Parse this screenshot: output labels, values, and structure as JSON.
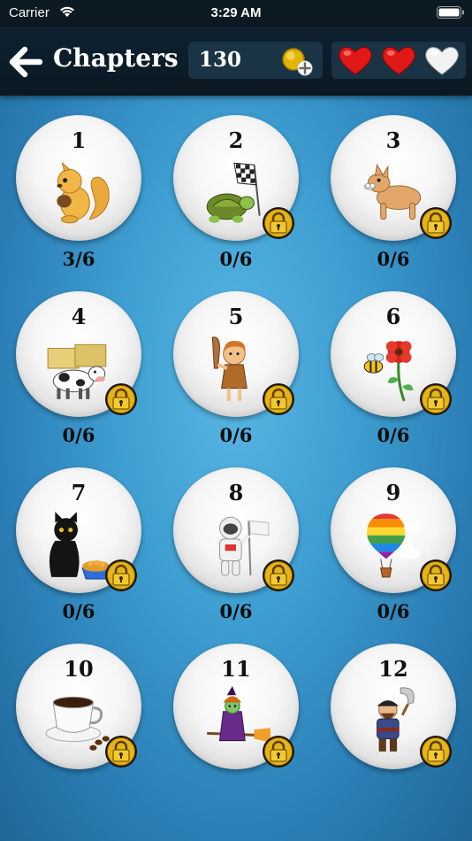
{
  "status_bar": {
    "carrier": "Carrier",
    "time": "3:29 AM"
  },
  "header": {
    "title": "Chapters",
    "coins": "130",
    "lives": [
      "full",
      "full",
      "empty"
    ]
  },
  "colors": {
    "heart_full": "#e01818",
    "heart_empty": "#f2f2f2",
    "coin": "#e0b400"
  },
  "chapters": [
    {
      "number": "1",
      "progress": "3/6",
      "locked": false,
      "icon": "squirrel-icon"
    },
    {
      "number": "2",
      "progress": "0/6",
      "locked": true,
      "icon": "turtle-flag-icon"
    },
    {
      "number": "3",
      "progress": "0/6",
      "locked": true,
      "icon": "dog-icon"
    },
    {
      "number": "4",
      "progress": "0/6",
      "locked": true,
      "icon": "cow-hay-icon"
    },
    {
      "number": "5",
      "progress": "0/6",
      "locked": true,
      "icon": "caveman-icon"
    },
    {
      "number": "6",
      "progress": "0/6",
      "locked": true,
      "icon": "bee-flower-icon"
    },
    {
      "number": "7",
      "progress": "0/6",
      "locked": true,
      "icon": "cat-food-icon"
    },
    {
      "number": "8",
      "progress": "0/6",
      "locked": true,
      "icon": "astronaut-icon"
    },
    {
      "number": "9",
      "progress": "0/6",
      "locked": true,
      "icon": "hot-air-balloon-icon"
    },
    {
      "number": "10",
      "progress": "",
      "locked": true,
      "icon": "coffee-cup-icon"
    },
    {
      "number": "11",
      "progress": "",
      "locked": true,
      "icon": "witch-broom-icon"
    },
    {
      "number": "12",
      "progress": "",
      "locked": true,
      "icon": "pirate-icon"
    }
  ]
}
